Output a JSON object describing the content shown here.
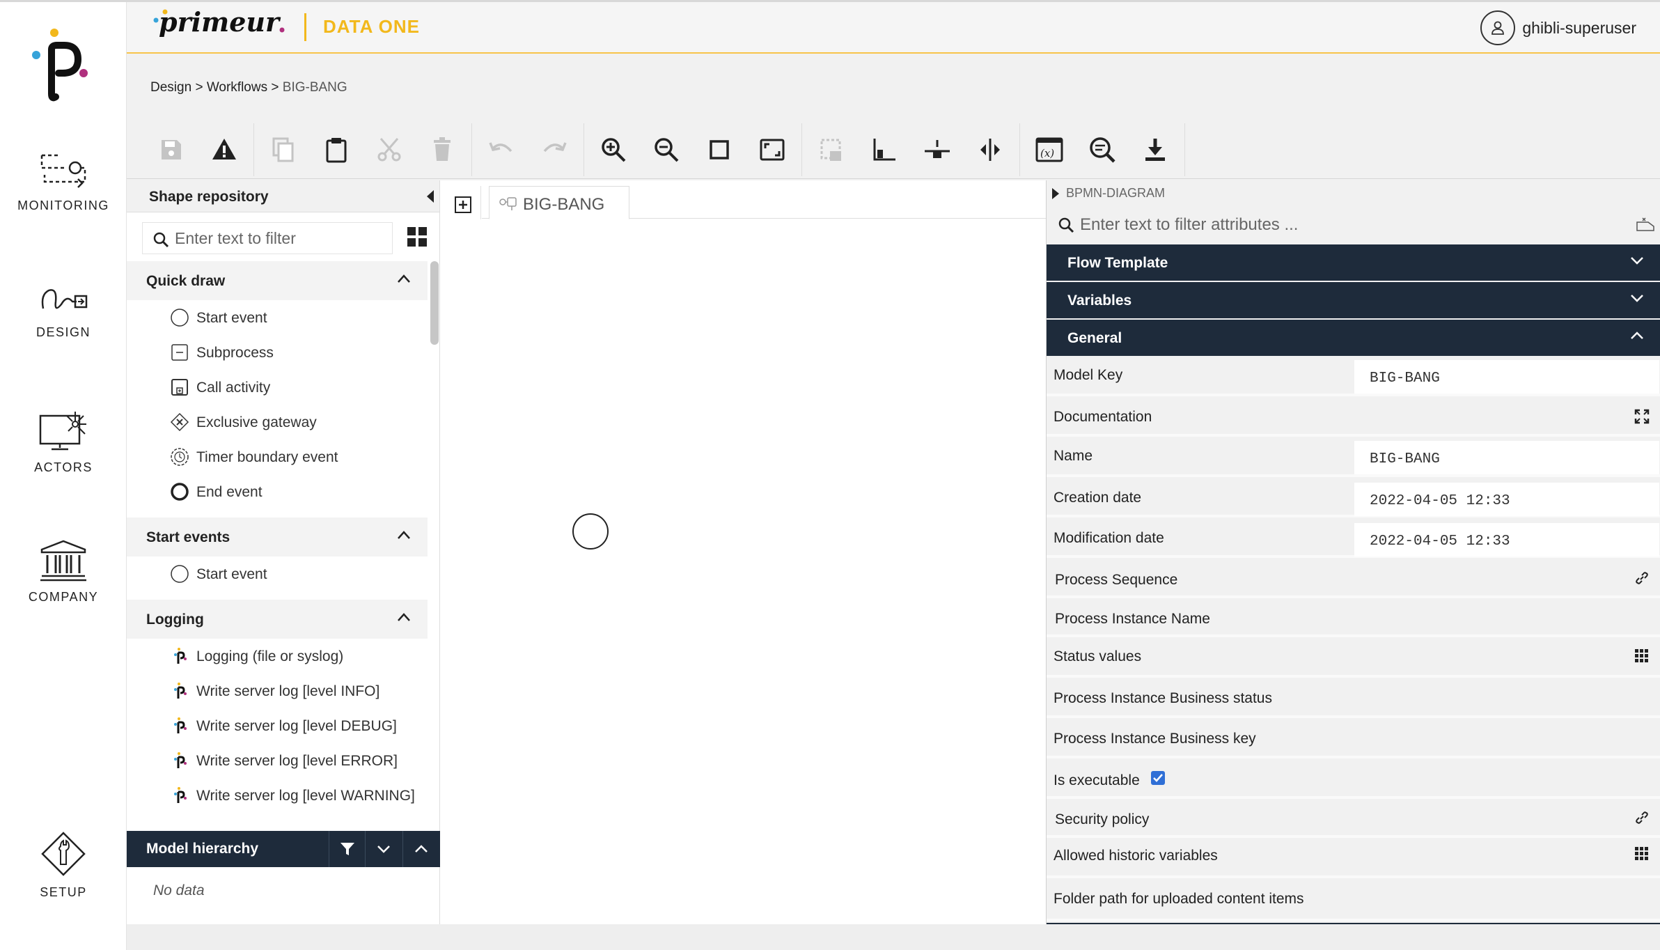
{
  "nav": {
    "items": [
      {
        "label": "MONITORING",
        "icon": "route-icon"
      },
      {
        "label": "DESIGN",
        "icon": "design-icon"
      },
      {
        "label": "ACTORS",
        "icon": "monitor-network-icon"
      },
      {
        "label": "COMPANY",
        "icon": "bank-icon"
      },
      {
        "label": "SETUP",
        "icon": "wrench-diamond-icon"
      }
    ]
  },
  "header": {
    "brand": "primeur",
    "product": "DATA ONE",
    "user": "ghibli-superuser",
    "accent_color": "#f2b81c"
  },
  "breadcrumb": {
    "items": [
      "Design",
      "Workflows"
    ],
    "separator": ">",
    "current": "BIG-BANG"
  },
  "toolbar": {
    "buttons": [
      "save-icon",
      "warning-icon",
      "copy-icon",
      "paste-icon",
      "cut-icon",
      "delete-icon",
      "undo-icon",
      "redo-icon",
      "zoom-in-icon",
      "zoom-out-icon",
      "zoom-actual-icon",
      "zoom-fit-icon",
      "select-area-icon",
      "align-bottom-left-icon",
      "align-middle-icon",
      "align-center-icon",
      "variables-icon",
      "search-replace-icon",
      "download-icon"
    ]
  },
  "repository": {
    "title": "Shape repository",
    "filter_placeholder": "Enter text to filter",
    "sections": [
      {
        "title": "Quick draw",
        "items": [
          "Start event",
          "Subprocess",
          "Call activity",
          "Exclusive gateway",
          "Timer boundary event",
          "End event"
        ]
      },
      {
        "title": "Start events",
        "items": [
          "Start event"
        ]
      },
      {
        "title": "Logging",
        "items": [
          "Logging (file or syslog)",
          "Write server log [level INFO]",
          "Write server log [level DEBUG]",
          "Write server log [level ERROR]",
          "Write server log [level WARNING]"
        ]
      }
    ],
    "hierarchy_title": "Model hierarchy",
    "hierarchy_empty": "No data"
  },
  "canvas": {
    "tab_label": "BIG-BANG"
  },
  "properties": {
    "title": "BPMN-DIAGRAM",
    "filter_placeholder": "Enter text to filter attributes ...",
    "sections": [
      "Flow Template",
      "Variables",
      "General"
    ],
    "general": {
      "model_key_label": "Model Key",
      "model_key_value": "BIG-BANG",
      "documentation_label": "Documentation",
      "name_label": "Name",
      "name_value": "BIG-BANG",
      "creation_label": "Creation date",
      "creation_value": "2022-04-05 12:33",
      "modification_label": "Modification date",
      "modification_value": "2022-04-05 12:33",
      "process_sequence_label": "Process Sequence",
      "instance_name_label": "Process Instance Name",
      "status_values_label": "Status values",
      "business_status_label": "Process Instance Business status",
      "business_key_label": "Process Instance Business key",
      "executable_label": "Is executable",
      "executable_checked": true,
      "security_label": "Security policy",
      "historic_label": "Allowed historic variables",
      "folder_label": "Folder path for uploaded content items"
    },
    "header_color": "#1e2b3b"
  }
}
